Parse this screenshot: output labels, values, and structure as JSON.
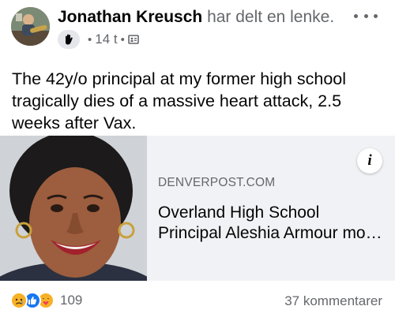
{
  "header": {
    "author_name": "Jonathan Kreusch",
    "action_text": "har delt en lenke.",
    "time_ago": "14 t",
    "badge_icon": "wave-hand-icon",
    "audience_icon": "friends-audience-icon"
  },
  "post": {
    "text": "The 42y/o principal at my former high school tragically dies of a massive heart attack, 2.5 weeks after Vax."
  },
  "link_preview": {
    "domain": "DENVERPOST.COM",
    "title_line1": "Overland High School",
    "title_line2": "Principal Aleshia Armour mo…",
    "info_label": "i"
  },
  "footer": {
    "reaction_count": "109",
    "comments": "37 kommentarer",
    "reaction_icons": [
      "sad-reaction-icon",
      "like-reaction-icon",
      "care-reaction-icon"
    ]
  },
  "colors": {
    "text_primary": "#050505",
    "text_secondary": "#65676b",
    "card_bg": "#f0f2f5",
    "like_blue": "#1877f2",
    "reaction_yellow": "#f7b125"
  }
}
